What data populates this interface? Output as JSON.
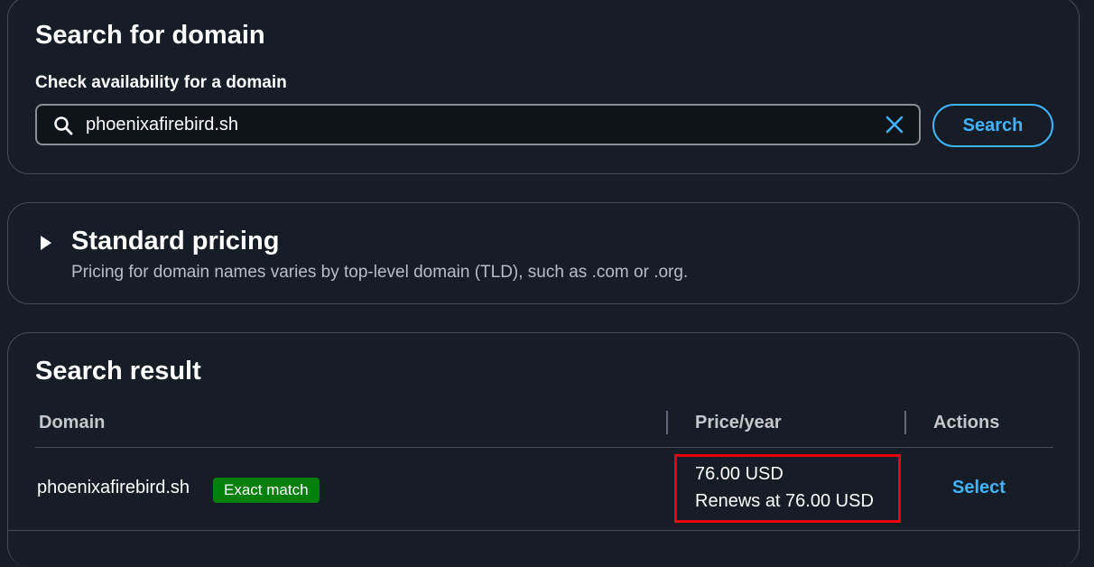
{
  "search_panel": {
    "title": "Search for domain",
    "field_label": "Check availability for a domain",
    "input_value": "phoenixafirebird.sh",
    "search_icon": "search-icon",
    "clear_icon": "close-icon",
    "search_button_label": "Search"
  },
  "pricing_panel": {
    "title": "Standard pricing",
    "description": "Pricing for domain names varies by top-level domain (TLD), such as .com or .org.",
    "expanded": false
  },
  "results_panel": {
    "title": "Search result",
    "columns": [
      "Domain",
      "Price/year",
      "Actions"
    ],
    "rows": [
      {
        "domain": "phoenixafirebird.sh",
        "badge": "Exact match",
        "price": "76.00 USD",
        "renewal": "Renews at 76.00 USD",
        "action": "Select"
      }
    ]
  },
  "colors": {
    "background": "#161d26",
    "accent": "#42b4ff",
    "badge_green": "#037f0c",
    "highlight_red": "#e8000b",
    "border": "#414d5c"
  }
}
